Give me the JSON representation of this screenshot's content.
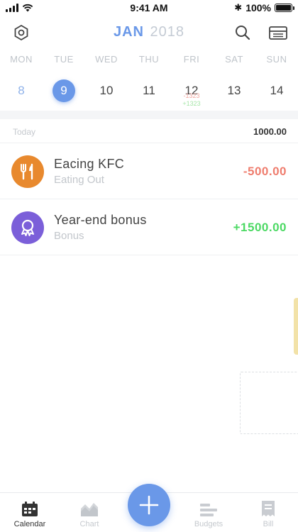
{
  "status_bar": {
    "time": "9:41 AM",
    "battery": "100%",
    "battery_level": 1.0
  },
  "header": {
    "month": "JAN",
    "year": "2018"
  },
  "week": [
    {
      "dow": "MON",
      "date": "8",
      "state": "past"
    },
    {
      "dow": "TUE",
      "date": "9",
      "state": "selected"
    },
    {
      "dow": "WED",
      "date": "10",
      "state": "normal"
    },
    {
      "dow": "THU",
      "date": "11",
      "state": "normal"
    },
    {
      "dow": "FRI",
      "date": "12",
      "state": "normal",
      "expense": "-1323",
      "income": "+1323"
    },
    {
      "dow": "SAT",
      "date": "13",
      "state": "normal"
    },
    {
      "dow": "SUN",
      "date": "14",
      "state": "normal"
    }
  ],
  "summary": {
    "label": "Today",
    "value": "1000.00"
  },
  "transactions": [
    {
      "title": "Eacing KFC",
      "category": "Eating Out",
      "amount": "-500.00",
      "type": "expense",
      "icon": "fork-knife-icon",
      "color": "#e8892e"
    },
    {
      "title": "Year-end bonus",
      "category": "Bonus",
      "amount": "+1500.00",
      "type": "income",
      "icon": "award-ribbon-icon",
      "color": "#7b5fd9"
    }
  ],
  "tabs": [
    {
      "label": "Calendar",
      "icon": "calendar-icon",
      "active": true
    },
    {
      "label": "Chart",
      "icon": "chart-icon",
      "active": false
    },
    {
      "label": "Budgets",
      "icon": "budgets-icon",
      "active": false
    },
    {
      "label": "Bill",
      "icon": "bill-icon",
      "active": false
    }
  ],
  "colors": {
    "accent": "#6a98e8",
    "expense": "#ef7d6e",
    "income": "#4cd964"
  }
}
